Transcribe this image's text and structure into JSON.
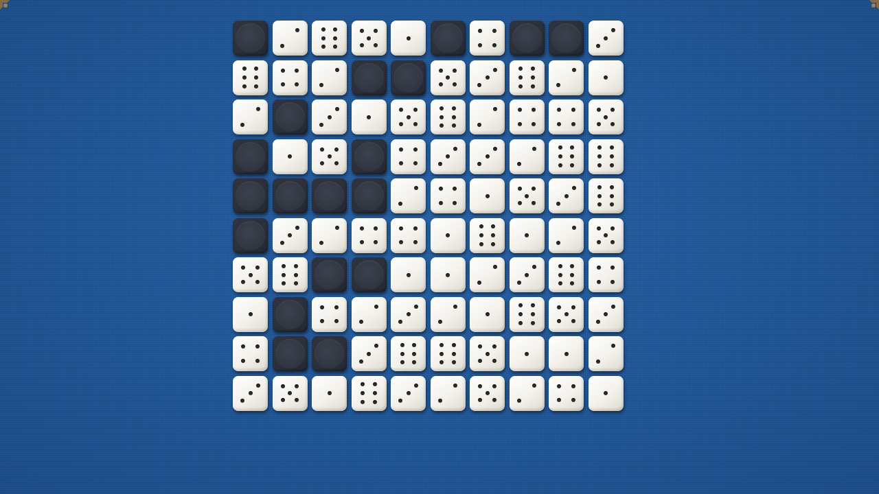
{
  "grid": {
    "rows": 10,
    "cols": 10,
    "cells": [
      [
        0,
        2,
        6,
        5,
        1,
        0,
        4,
        0,
        0,
        3
      ],
      [
        6,
        4,
        2,
        0,
        0,
        5,
        3,
        6,
        2,
        1
      ],
      [
        2,
        0,
        3,
        1,
        5,
        6,
        2,
        4,
        4,
        5
      ],
      [
        0,
        1,
        5,
        0,
        4,
        3,
        3,
        2,
        6,
        6
      ],
      [
        0,
        0,
        0,
        0,
        2,
        4,
        1,
        5,
        3,
        6
      ],
      [
        0,
        3,
        2,
        4,
        4,
        1,
        6,
        1,
        2,
        5
      ],
      [
        5,
        6,
        0,
        0,
        1,
        1,
        2,
        3,
        6,
        4
      ],
      [
        1,
        0,
        4,
        2,
        3,
        2,
        1,
        6,
        5,
        3
      ],
      [
        4,
        0,
        0,
        3,
        6,
        6,
        5,
        1,
        1,
        2
      ],
      [
        3,
        5,
        1,
        6,
        3,
        2,
        5,
        2,
        4,
        1
      ]
    ]
  },
  "colors": {
    "felt": "#1f5596",
    "die_face": "#f7f5ef",
    "pip": "#2a2a2a",
    "blocked": "#2f3440"
  },
  "icons": {
    "corner_left": "ornament-corner-icon",
    "corner_right": "ornament-corner-icon"
  }
}
